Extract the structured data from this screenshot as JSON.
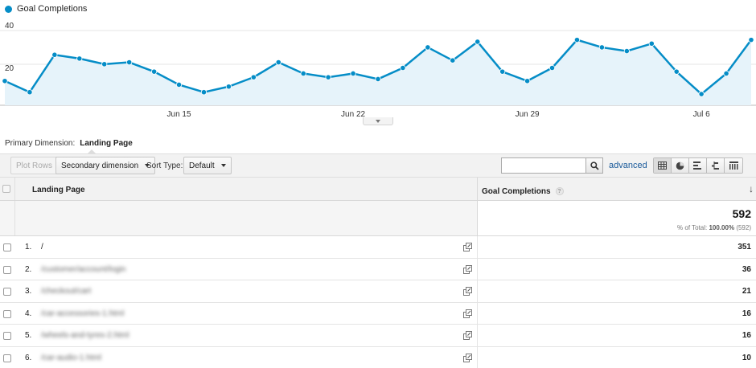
{
  "chart_data": {
    "type": "area",
    "series": [
      {
        "name": "Goal Completions",
        "color": "#058dc7",
        "values": [
          13,
          7,
          27,
          25,
          22,
          23,
          18,
          11,
          7,
          10,
          15,
          23,
          17,
          15,
          17,
          14,
          20,
          31,
          24,
          34,
          18,
          13,
          20,
          35,
          31,
          29,
          33,
          18,
          6,
          17,
          35
        ]
      }
    ],
    "y_ticks": [
      "40",
      "20"
    ],
    "ylim": [
      0,
      40
    ],
    "x_ticks": [
      "Jun 15",
      "Jun 22",
      "Jun 29",
      "Jul 6"
    ],
    "grid": true,
    "legend_position": "top-left"
  },
  "legend": {
    "label": "Goal Completions",
    "color": "#058dc7"
  },
  "primary_dimension": {
    "label": "Primary Dimension:",
    "value": "Landing Page"
  },
  "toolbar": {
    "plot_rows": "Plot Rows",
    "secondary_dimension": "Secondary dimension",
    "sort_type_label": "Sort Type:",
    "sort_type_value": "Default",
    "search_value": "",
    "advanced": "advanced",
    "view_icons": [
      "table-view-icon",
      "pie-view-icon",
      "bar-view-icon",
      "comparison-view-icon",
      "pivot-view-icon"
    ]
  },
  "table": {
    "columns": {
      "dimension": "Landing Page",
      "metric": "Goal Completions",
      "help": "?",
      "sort_arrow": "↓"
    },
    "total": {
      "value": "592",
      "pct_label": "% of Total:",
      "pct_value": "100.00%",
      "pct_total": "(592)"
    },
    "rows": [
      {
        "num": "1.",
        "page": "/",
        "blurred": false,
        "value": "351"
      },
      {
        "num": "2.",
        "page": "/customer/account/login",
        "blurred": true,
        "value": "36"
      },
      {
        "num": "3.",
        "page": "/checkout/cart",
        "blurred": true,
        "value": "21"
      },
      {
        "num": "4.",
        "page": "/car-accessories-1.html",
        "blurred": true,
        "value": "16"
      },
      {
        "num": "5.",
        "page": "/wheels-and-tyres-2.html",
        "blurred": true,
        "value": "16"
      },
      {
        "num": "6.",
        "page": "/car-audio-1.html",
        "blurred": true,
        "value": "10"
      }
    ]
  }
}
